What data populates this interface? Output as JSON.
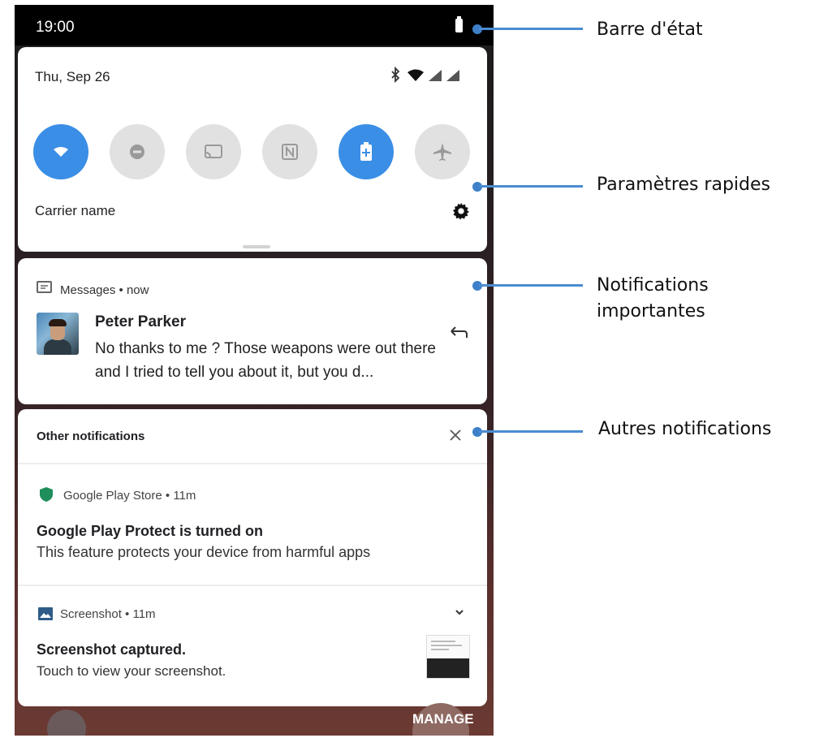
{
  "statusbar": {
    "time": "19:00"
  },
  "quick_settings": {
    "date": "Thu, Sep 26",
    "carrier": "Carrier name",
    "tiles": [
      {
        "name": "wifi",
        "active": true
      },
      {
        "name": "do-not-disturb",
        "active": false
      },
      {
        "name": "cast",
        "active": false
      },
      {
        "name": "nfc",
        "active": false
      },
      {
        "name": "battery-saver",
        "active": true
      },
      {
        "name": "airplane-mode",
        "active": false
      }
    ],
    "accent": "#3a8ee6"
  },
  "messages": {
    "app": "Messages • now",
    "sender": "Peter Parker",
    "text": "No thanks to me ? Those weapons were out there and I tried  to  tell you about it, but you d..."
  },
  "other": {
    "header": "Other notifications",
    "play": {
      "app": "Google Play Store • 11m",
      "title": "Google Play Protect is turned on",
      "text": "This feature protects your device from harmful apps"
    },
    "screenshot": {
      "app": "Screenshot • 11m",
      "title": "Screenshot captured.",
      "text": "Touch to view your screenshot."
    }
  },
  "launcher": {
    "manage": "MANAGE"
  },
  "callouts": {
    "status_bar": "Barre d'état",
    "quick_settings": "Paramètres rapides",
    "important": "Notifications importantes",
    "other": "Autres notifications"
  }
}
